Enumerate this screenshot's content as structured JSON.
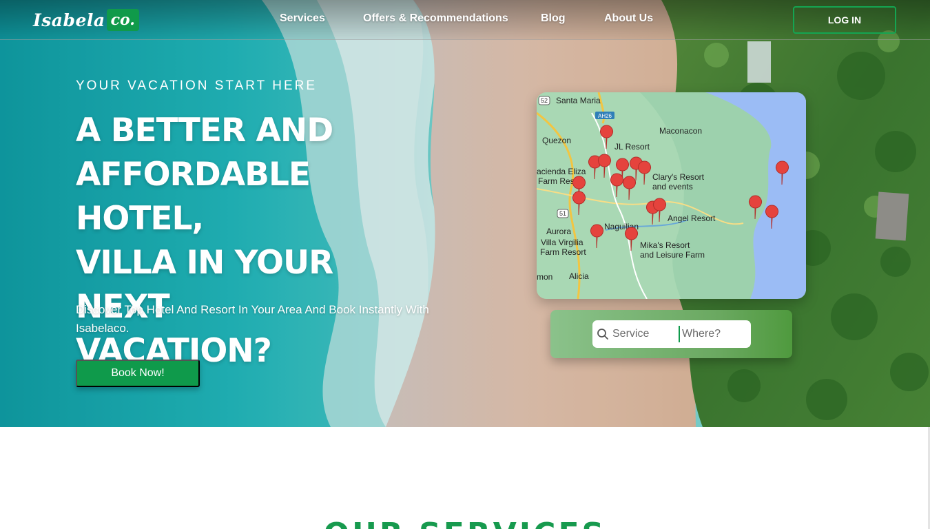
{
  "header": {
    "logo_text": "Isabela",
    "logo_badge": "co.",
    "nav": [
      {
        "label": "Services"
      },
      {
        "label": "Offers & Recommendations"
      },
      {
        "label": "Blog"
      },
      {
        "label": "About Us"
      }
    ],
    "login_label": "LOG IN"
  },
  "hero": {
    "tagline": "YOUR VACATION START HERE",
    "headline_lines": [
      "A BETTER AND",
      "AFFORDABLE HOTEL,",
      "VILLA IN YOUR NEXT",
      "VACATION?"
    ],
    "description": "Discover Top Hotel And Resort In Your Area And Book Instantly With Isabelaco.",
    "book_button": "Book Now!"
  },
  "map": {
    "places": [
      {
        "label": "Santa Maria"
      },
      {
        "label": "Maconacon"
      },
      {
        "label": "Quezon"
      },
      {
        "label": "JL Resort"
      },
      {
        "label": "acienda Eliza"
      },
      {
        "label": "Farm Resort"
      },
      {
        "label": "Clary's Resort"
      },
      {
        "label": "and events"
      },
      {
        "label": "Angel Resort"
      },
      {
        "label": "Naguilian"
      },
      {
        "label": "Aurora"
      },
      {
        "label": "Villa Virgilia"
      },
      {
        "label": "Farm Resort"
      },
      {
        "label": "Mika's Resort"
      },
      {
        "label": "and Leisure Farm"
      },
      {
        "label": "Alicia"
      },
      {
        "label": "mon"
      }
    ],
    "road_shields": [
      "52",
      "AH26",
      "51"
    ],
    "colors": {
      "land": "#a9d8b4",
      "sea": "#9bbcf5",
      "road": "#f2c542",
      "pin": "#e5433d"
    }
  },
  "search": {
    "service_placeholder": "Service",
    "where_placeholder": "Where?"
  },
  "section": {
    "title": "OUR SERVICES"
  },
  "colors": {
    "brand_green": "#0f9a4b",
    "ocean": "#1fb3b8",
    "sand": "#e8c7b0"
  }
}
